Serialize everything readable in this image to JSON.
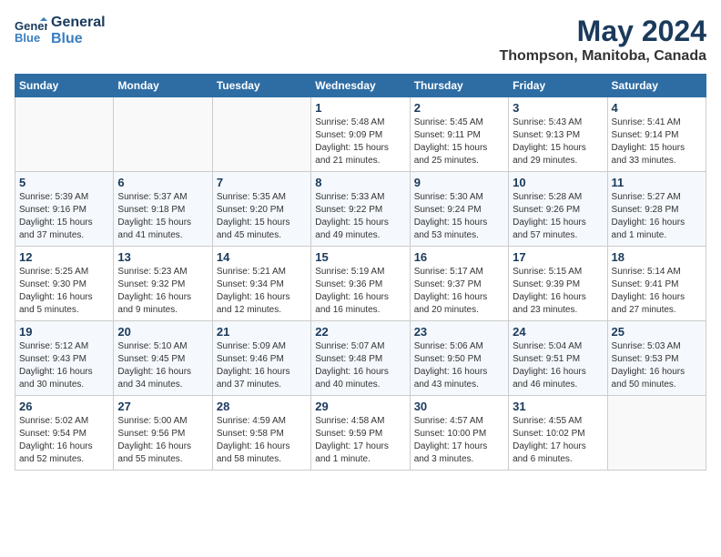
{
  "header": {
    "logo_line1": "General",
    "logo_line2": "Blue",
    "main_title": "May 2024",
    "subtitle": "Thompson, Manitoba, Canada"
  },
  "days_of_week": [
    "Sunday",
    "Monday",
    "Tuesday",
    "Wednesday",
    "Thursday",
    "Friday",
    "Saturday"
  ],
  "weeks": [
    [
      {
        "day": "",
        "detail": ""
      },
      {
        "day": "",
        "detail": ""
      },
      {
        "day": "",
        "detail": ""
      },
      {
        "day": "1",
        "detail": "Sunrise: 5:48 AM\nSunset: 9:09 PM\nDaylight: 15 hours\nand 21 minutes."
      },
      {
        "day": "2",
        "detail": "Sunrise: 5:45 AM\nSunset: 9:11 PM\nDaylight: 15 hours\nand 25 minutes."
      },
      {
        "day": "3",
        "detail": "Sunrise: 5:43 AM\nSunset: 9:13 PM\nDaylight: 15 hours\nand 29 minutes."
      },
      {
        "day": "4",
        "detail": "Sunrise: 5:41 AM\nSunset: 9:14 PM\nDaylight: 15 hours\nand 33 minutes."
      }
    ],
    [
      {
        "day": "5",
        "detail": "Sunrise: 5:39 AM\nSunset: 9:16 PM\nDaylight: 15 hours\nand 37 minutes."
      },
      {
        "day": "6",
        "detail": "Sunrise: 5:37 AM\nSunset: 9:18 PM\nDaylight: 15 hours\nand 41 minutes."
      },
      {
        "day": "7",
        "detail": "Sunrise: 5:35 AM\nSunset: 9:20 PM\nDaylight: 15 hours\nand 45 minutes."
      },
      {
        "day": "8",
        "detail": "Sunrise: 5:33 AM\nSunset: 9:22 PM\nDaylight: 15 hours\nand 49 minutes."
      },
      {
        "day": "9",
        "detail": "Sunrise: 5:30 AM\nSunset: 9:24 PM\nDaylight: 15 hours\nand 53 minutes."
      },
      {
        "day": "10",
        "detail": "Sunrise: 5:28 AM\nSunset: 9:26 PM\nDaylight: 15 hours\nand 57 minutes."
      },
      {
        "day": "11",
        "detail": "Sunrise: 5:27 AM\nSunset: 9:28 PM\nDaylight: 16 hours\nand 1 minute."
      }
    ],
    [
      {
        "day": "12",
        "detail": "Sunrise: 5:25 AM\nSunset: 9:30 PM\nDaylight: 16 hours\nand 5 minutes."
      },
      {
        "day": "13",
        "detail": "Sunrise: 5:23 AM\nSunset: 9:32 PM\nDaylight: 16 hours\nand 9 minutes."
      },
      {
        "day": "14",
        "detail": "Sunrise: 5:21 AM\nSunset: 9:34 PM\nDaylight: 16 hours\nand 12 minutes."
      },
      {
        "day": "15",
        "detail": "Sunrise: 5:19 AM\nSunset: 9:36 PM\nDaylight: 16 hours\nand 16 minutes."
      },
      {
        "day": "16",
        "detail": "Sunrise: 5:17 AM\nSunset: 9:37 PM\nDaylight: 16 hours\nand 20 minutes."
      },
      {
        "day": "17",
        "detail": "Sunrise: 5:15 AM\nSunset: 9:39 PM\nDaylight: 16 hours\nand 23 minutes."
      },
      {
        "day": "18",
        "detail": "Sunrise: 5:14 AM\nSunset: 9:41 PM\nDaylight: 16 hours\nand 27 minutes."
      }
    ],
    [
      {
        "day": "19",
        "detail": "Sunrise: 5:12 AM\nSunset: 9:43 PM\nDaylight: 16 hours\nand 30 minutes."
      },
      {
        "day": "20",
        "detail": "Sunrise: 5:10 AM\nSunset: 9:45 PM\nDaylight: 16 hours\nand 34 minutes."
      },
      {
        "day": "21",
        "detail": "Sunrise: 5:09 AM\nSunset: 9:46 PM\nDaylight: 16 hours\nand 37 minutes."
      },
      {
        "day": "22",
        "detail": "Sunrise: 5:07 AM\nSunset: 9:48 PM\nDaylight: 16 hours\nand 40 minutes."
      },
      {
        "day": "23",
        "detail": "Sunrise: 5:06 AM\nSunset: 9:50 PM\nDaylight: 16 hours\nand 43 minutes."
      },
      {
        "day": "24",
        "detail": "Sunrise: 5:04 AM\nSunset: 9:51 PM\nDaylight: 16 hours\nand 46 minutes."
      },
      {
        "day": "25",
        "detail": "Sunrise: 5:03 AM\nSunset: 9:53 PM\nDaylight: 16 hours\nand 50 minutes."
      }
    ],
    [
      {
        "day": "26",
        "detail": "Sunrise: 5:02 AM\nSunset: 9:54 PM\nDaylight: 16 hours\nand 52 minutes."
      },
      {
        "day": "27",
        "detail": "Sunrise: 5:00 AM\nSunset: 9:56 PM\nDaylight: 16 hours\nand 55 minutes."
      },
      {
        "day": "28",
        "detail": "Sunrise: 4:59 AM\nSunset: 9:58 PM\nDaylight: 16 hours\nand 58 minutes."
      },
      {
        "day": "29",
        "detail": "Sunrise: 4:58 AM\nSunset: 9:59 PM\nDaylight: 17 hours\nand 1 minute."
      },
      {
        "day": "30",
        "detail": "Sunrise: 4:57 AM\nSunset: 10:00 PM\nDaylight: 17 hours\nand 3 minutes."
      },
      {
        "day": "31",
        "detail": "Sunrise: 4:55 AM\nSunset: 10:02 PM\nDaylight: 17 hours\nand 6 minutes."
      },
      {
        "day": "",
        "detail": ""
      }
    ]
  ]
}
